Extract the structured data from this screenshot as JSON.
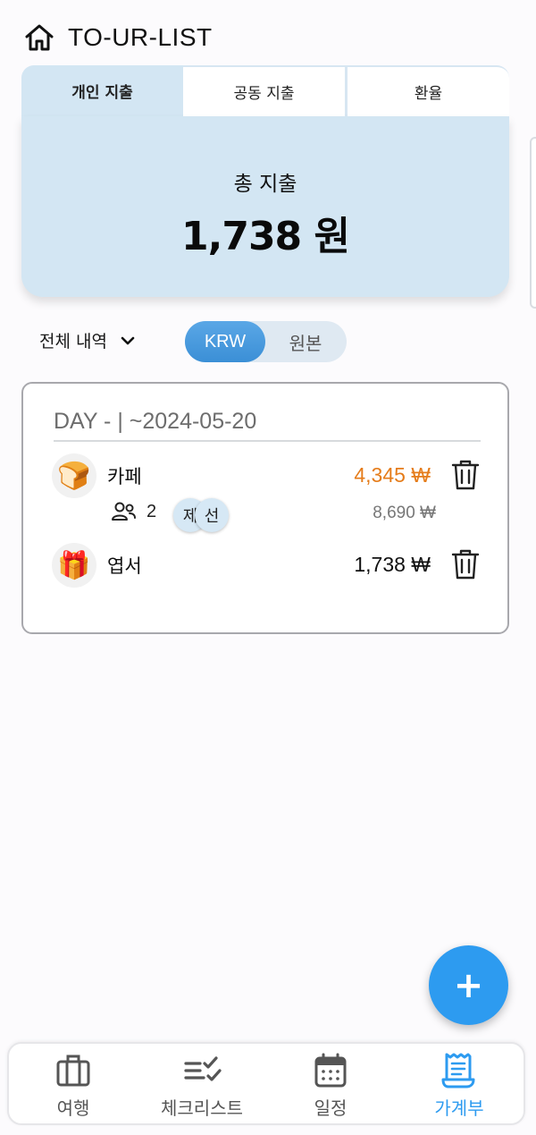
{
  "header": {
    "title": "TO-UR-LIST",
    "home_icon": "home-icon"
  },
  "tabs": [
    {
      "label": "개인 지출",
      "active": true
    },
    {
      "label": "공동 지출",
      "active": false
    },
    {
      "label": "환율",
      "active": false
    }
  ],
  "summary": {
    "label": "총 지출",
    "amount": "1,738 원"
  },
  "filter": {
    "label": "전체 내역"
  },
  "currency_toggle": {
    "options": [
      "KRW",
      "원본"
    ],
    "selected": "KRW"
  },
  "day_group": {
    "header": "DAY - | ~2024-05-20",
    "items": [
      {
        "name": "카페",
        "icon": "bread-emoji",
        "price": "4,345 ₩",
        "price_color": "#e57c1a",
        "participants_count": "2",
        "participants": [
          "제",
          "선"
        ],
        "sub_price": "8,690 ₩"
      },
      {
        "name": "엽서",
        "icon": "gift-emoji",
        "price": "1,738 ₩",
        "price_color": "#111111"
      }
    ]
  },
  "fab": {
    "label": "+"
  },
  "bottom_nav": [
    {
      "label": "여행",
      "icon": "suitcase-icon",
      "active": false
    },
    {
      "label": "체크리스트",
      "icon": "checklist-icon",
      "active": false
    },
    {
      "label": "일정",
      "icon": "calendar-icon",
      "active": false
    },
    {
      "label": "가계부",
      "icon": "receipt-icon",
      "active": true
    }
  ],
  "colors": {
    "accent": "#2d9bf0",
    "summary_bg": "#d3e6f3",
    "orange": "#e57c1a"
  }
}
